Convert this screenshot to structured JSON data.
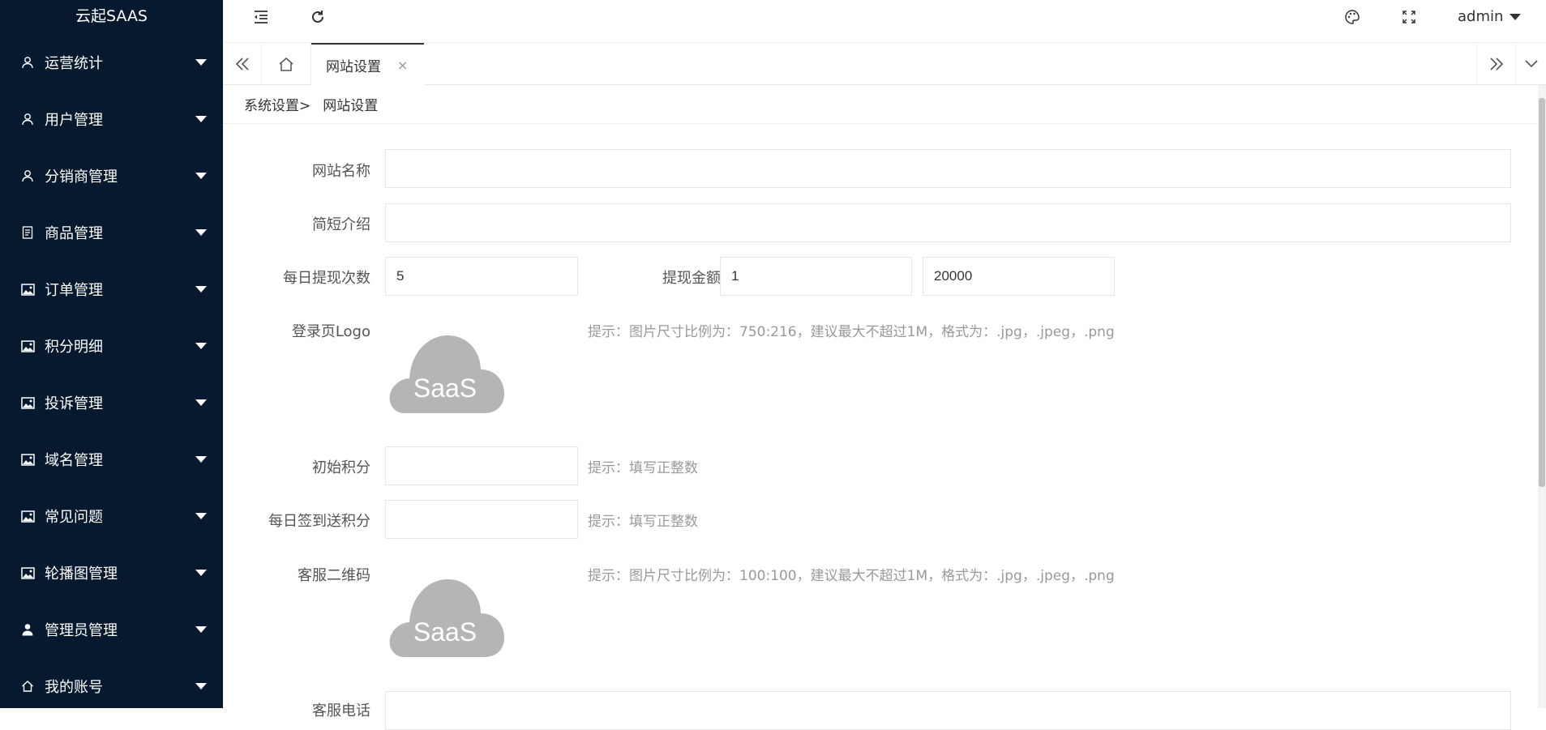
{
  "app": {
    "title": "云起SAAS",
    "user": "admin"
  },
  "sidebar": {
    "items": [
      {
        "label": "运营统计",
        "icon": "user-icon"
      },
      {
        "label": "用户管理",
        "icon": "user-icon"
      },
      {
        "label": "分销商管理",
        "icon": "user-icon"
      },
      {
        "label": "商品管理",
        "icon": "document-icon"
      },
      {
        "label": "订单管理",
        "icon": "image-icon"
      },
      {
        "label": "积分明细",
        "icon": "image-icon"
      },
      {
        "label": "投诉管理",
        "icon": "image-icon"
      },
      {
        "label": "域名管理",
        "icon": "image-icon"
      },
      {
        "label": "常见问题",
        "icon": "image-icon"
      },
      {
        "label": "轮播图管理",
        "icon": "image-icon"
      },
      {
        "label": "管理员管理",
        "icon": "person-icon"
      },
      {
        "label": "我的账号",
        "icon": "home-icon"
      }
    ]
  },
  "tabs": {
    "active": "网站设置",
    "close": "×"
  },
  "breadcrumb": {
    "parent": "系统设置>",
    "current": "网站设置"
  },
  "form": {
    "site_name": {
      "label": "网站名称",
      "value": ""
    },
    "intro": {
      "label": "简短介绍",
      "value": ""
    },
    "daily_withdraw": {
      "label": "每日提现次数",
      "value": "5"
    },
    "withdraw_amount": {
      "label": "提现金额",
      "min": "1",
      "max": "20000"
    },
    "login_logo": {
      "label": "登录页Logo",
      "hint": "提示：图片尺寸比例为：750:216，建议最大不超过1M，格式为：.jpg，.jpeg，.png",
      "image_text": "SaaS"
    },
    "initial_points": {
      "label": "初始积分",
      "value": "",
      "hint": "提示：填写正整数"
    },
    "daily_signin_points": {
      "label": "每日签到送积分",
      "value": "",
      "hint": "提示：填写正整数"
    },
    "service_qrcode": {
      "label": "客服二维码",
      "hint": "提示：图片尺寸比例为：100:100，建议最大不超过1M，格式为：.jpg，.jpeg，.png",
      "image_text": "SaaS"
    },
    "service_phone": {
      "label": "客服电话",
      "value": ""
    }
  },
  "colors": {
    "sidebar_bg": "#06192f",
    "cloud": "#b5b5b5"
  }
}
